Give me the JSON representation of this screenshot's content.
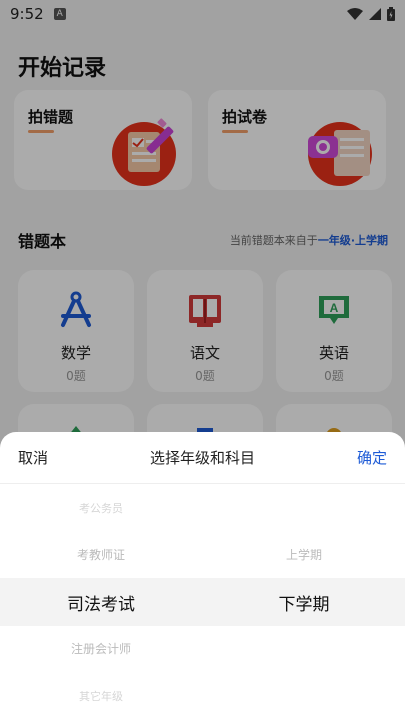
{
  "status": {
    "time": "9:52",
    "a_badge": "A"
  },
  "page": {
    "title": "开始记录"
  },
  "capture": {
    "mistake": {
      "label": "拍错题"
    },
    "exam": {
      "label": "拍试卷"
    }
  },
  "notebook": {
    "heading": "错题本",
    "note_prefix": "当前错题本来自于",
    "grade": "一年级",
    "separator": "·",
    "term": "上学期"
  },
  "subjects": [
    {
      "name": "数学",
      "count": "0题",
      "icon": "compass-icon",
      "color": "#1e5bd6"
    },
    {
      "name": "语文",
      "count": "0题",
      "icon": "book-icon",
      "color": "#d33b3b"
    },
    {
      "name": "英语",
      "count": "0题",
      "icon": "speech-bubble-icon",
      "color": "#2fa05a"
    }
  ],
  "sheet": {
    "cancel": "取消",
    "title": "选择年级和科目",
    "confirm": "确定",
    "left_options": [
      "考公务员",
      "考教师证",
      "司法考试",
      "注册会计师",
      "其它年级"
    ],
    "right_options": [
      "上学期",
      "下学期"
    ]
  }
}
